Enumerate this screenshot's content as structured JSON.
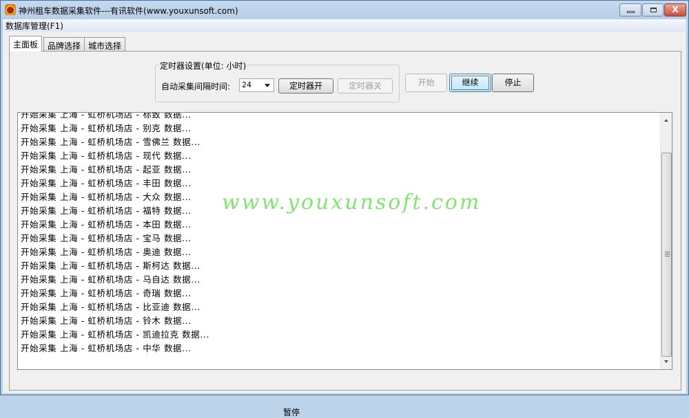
{
  "window": {
    "title": "神州租车数据采集软件---有讯软件(www.youxunsoft.com)",
    "close_label": "X"
  },
  "menu": {
    "items": [
      {
        "label": "数据库管理(F1)"
      }
    ]
  },
  "tabs": [
    {
      "label": "主面板",
      "active": true
    },
    {
      "label": "品牌选择"
    },
    {
      "label": "城市选择"
    }
  ],
  "timer": {
    "group_label": "定时器设置(单位: 小时)",
    "interval_label": "自动采集间隔时间:",
    "interval_value": "24",
    "on_label": "定时器开",
    "off_label": "定时器关"
  },
  "actions": {
    "start_label": "开始",
    "continue_label": "继续",
    "stop_label": "停止"
  },
  "log": [
    "开始采集 上海 - 虹桥机场店 - 标致 数据...",
    "开始采集 上海 - 虹桥机场店 - 别克 数据...",
    "开始采集 上海 - 虹桥机场店 - 雪佛兰 数据...",
    "开始采集 上海 - 虹桥机场店 - 现代 数据...",
    "开始采集 上海 - 虹桥机场店 - 起亚 数据...",
    "开始采集 上海 - 虹桥机场店 - 丰田 数据...",
    "开始采集 上海 - 虹桥机场店 - 大众 数据...",
    "开始采集 上海 - 虹桥机场店 - 福特 数据...",
    "开始采集 上海 - 虹桥机场店 - 本田 数据...",
    "开始采集 上海 - 虹桥机场店 - 宝马 数据...",
    "开始采集 上海 - 虹桥机场店 - 奥迪 数据...",
    "开始采集 上海 - 虹桥机场店 - 斯柯达 数据...",
    "开始采集 上海 - 虹桥机场店 - 马自达 数据...",
    "开始采集 上海 - 虹桥机场店 - 奇瑞 数据...",
    "开始采集 上海 - 虹桥机场店 - 比亚迪 数据...",
    "开始采集 上海 - 虹桥机场店 - 铃木 数据...",
    "开始采集 上海 - 虹桥机场店 - 凯迪拉克 数据...",
    "开始采集 上海 - 虹桥机场店 - 中华 数据..."
  ],
  "watermark": "www.youxunsoft.com",
  "status": "暂停",
  "colors": {
    "watermark": "#7fe56f"
  }
}
